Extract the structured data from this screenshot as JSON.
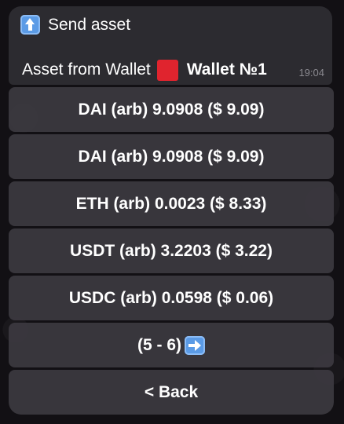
{
  "message": {
    "title": "Send asset",
    "title_icon": "up-arrow-emoji",
    "text": "Asset from Wallet",
    "wallet_flag_color": "#e0242e",
    "wallet_name": "Wallet №1",
    "time": "19:04"
  },
  "keyboard": {
    "buttons": [
      {
        "label": "DAI (arb) 9.0908 ($ 9.09)"
      },
      {
        "label": "DAI (arb) 9.0908 ($ 9.09)"
      },
      {
        "label": "ETH (arb) 0.0023 ($ 8.33)"
      },
      {
        "label": "USDT (arb) 3.2203 ($ 3.22)"
      },
      {
        "label": "USDC (arb) 0.0598 ($ 0.06)"
      },
      {
        "label": "(5 - 6)",
        "icon": "right-arrow-emoji"
      },
      {
        "label": "< Back"
      }
    ]
  }
}
